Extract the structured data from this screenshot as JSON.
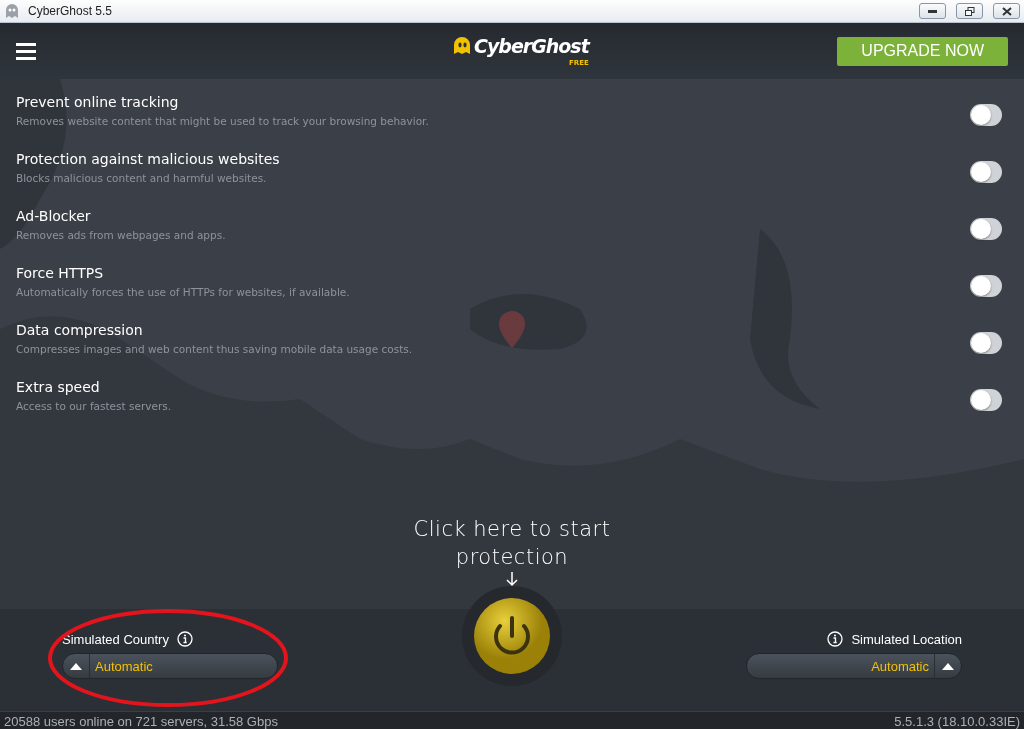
{
  "window": {
    "title": "CyberGhost 5.5"
  },
  "header": {
    "logo_text": "CyberGhost",
    "logo_badge": "FREE",
    "upgrade_button": "UPGRADE NOW"
  },
  "settings": [
    {
      "title": "Prevent online tracking",
      "description": "Removes website content that might be used to track your browsing behavior.",
      "on": false
    },
    {
      "title": "Protection against malicious websites",
      "description": "Blocks malicious content and harmful websites.",
      "on": false
    },
    {
      "title": "Ad-Blocker",
      "description": "Removes ads from webpages and apps.",
      "on": false
    },
    {
      "title": "Force HTTPS",
      "description": "Automatically forces the use of HTTPs for websites, if available.",
      "on": false
    },
    {
      "title": "Data compression",
      "description": "Compresses images and web content thus saving mobile data usage costs.",
      "on": false
    },
    {
      "title": "Extra speed",
      "description": "Access to our fastest servers.",
      "on": false
    }
  ],
  "hint": {
    "line_1": "Click here to start",
    "line_2": "protection"
  },
  "country": {
    "label": "Simulated Country",
    "value": "Automatic"
  },
  "location": {
    "label": "Simulated Location",
    "value": "Automatic"
  },
  "status_bar": {
    "left": "20588 users online on 721 servers, 31.58 Gbps",
    "right": "5.5.1.3 (18.10.0.33IE)"
  }
}
